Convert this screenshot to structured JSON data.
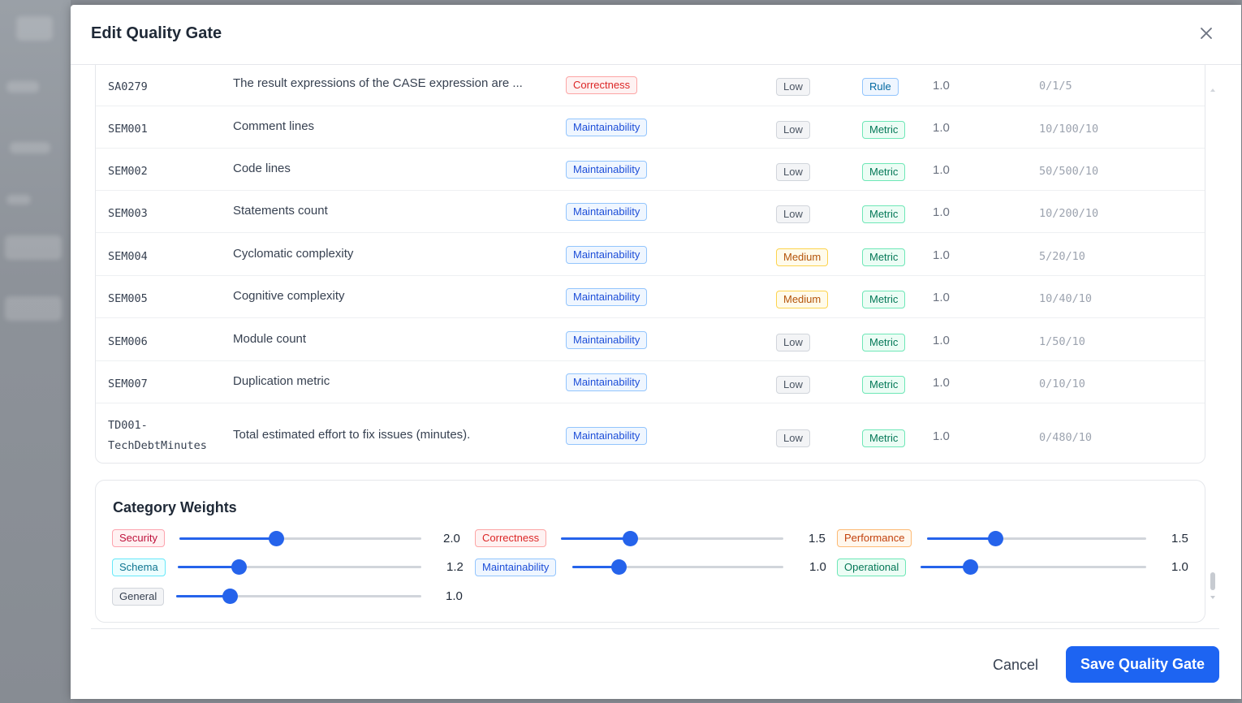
{
  "modal": {
    "title": "Edit Quality Gate"
  },
  "rows": [
    {
      "id": "SA0279",
      "desc": "The result expressions of the CASE expression are ...",
      "category": "Correctness",
      "severity": "Low",
      "kind": "Rule",
      "weight": "1.0",
      "threshold": "0/1/5"
    },
    {
      "id": "SEM001",
      "desc": "Comment lines",
      "category": "Maintainability",
      "severity": "Low",
      "kind": "Metric",
      "weight": "1.0",
      "threshold": "10/100/10"
    },
    {
      "id": "SEM002",
      "desc": "Code lines",
      "category": "Maintainability",
      "severity": "Low",
      "kind": "Metric",
      "weight": "1.0",
      "threshold": "50/500/10"
    },
    {
      "id": "SEM003",
      "desc": "Statements count",
      "category": "Maintainability",
      "severity": "Low",
      "kind": "Metric",
      "weight": "1.0",
      "threshold": "10/200/10"
    },
    {
      "id": "SEM004",
      "desc": "Cyclomatic complexity",
      "category": "Maintainability",
      "severity": "Medium",
      "kind": "Metric",
      "weight": "1.0",
      "threshold": "5/20/10"
    },
    {
      "id": "SEM005",
      "desc": "Cognitive complexity",
      "category": "Maintainability",
      "severity": "Medium",
      "kind": "Metric",
      "weight": "1.0",
      "threshold": "10/40/10"
    },
    {
      "id": "SEM006",
      "desc": "Module count",
      "category": "Maintainability",
      "severity": "Low",
      "kind": "Metric",
      "weight": "1.0",
      "threshold": "1/50/10"
    },
    {
      "id": "SEM007",
      "desc": "Duplication metric",
      "category": "Maintainability",
      "severity": "Low",
      "kind": "Metric",
      "weight": "1.0",
      "threshold": "0/10/10"
    },
    {
      "id_line1": "TD001-",
      "id_line2": "TechDebtMinutes",
      "desc": "Total estimated effort to fix issues (minutes).",
      "category": "Maintainability",
      "severity": "Low",
      "kind": "Metric",
      "weight": "1.0",
      "threshold": "0/480/10"
    }
  ],
  "weights": {
    "title": "Category Weights",
    "items": [
      {
        "label": "Security",
        "value": "2.0",
        "fraction": 0.4
      },
      {
        "label": "Correctness",
        "value": "1.5",
        "fraction": 0.31
      },
      {
        "label": "Performance",
        "value": "1.5",
        "fraction": 0.31
      },
      {
        "label": "Schema",
        "value": "1.2",
        "fraction": 0.25
      },
      {
        "label": "Maintainability",
        "value": "1.0",
        "fraction": 0.22
      },
      {
        "label": "Operational",
        "value": "1.0",
        "fraction": 0.22
      },
      {
        "label": "General",
        "value": "1.0",
        "fraction": 0.22
      }
    ]
  },
  "footer": {
    "cancel_label": "Cancel",
    "save_label": "Save Quality Gate"
  },
  "colors": {
    "accent": "#2563eb",
    "save_button": "#1d64f2"
  },
  "icons": {
    "close": "close-icon",
    "scroll_up": "chevron-up-icon",
    "scroll_down": "chevron-down-icon"
  }
}
